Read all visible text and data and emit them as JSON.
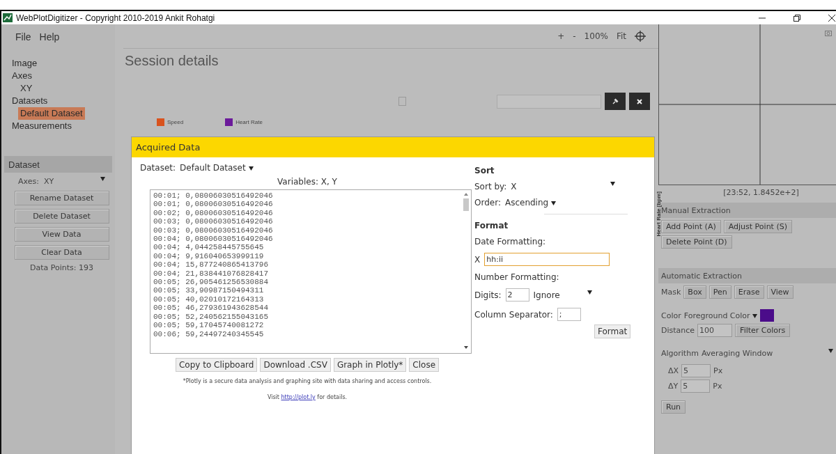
{
  "window": {
    "title": "WebPlotDigitizer - Copyright 2010-2019 Ankit Rohatgi"
  },
  "menu": [
    "File",
    "Help"
  ],
  "sidebar": {
    "items": [
      {
        "label": "Image",
        "selected": false
      },
      {
        "label": "Axes",
        "selected": false,
        "children": [
          {
            "label": "XY",
            "selected": false
          }
        ]
      },
      {
        "label": "Datasets",
        "selected": false,
        "children": [
          {
            "label": "Default Dataset",
            "selected": true
          }
        ]
      },
      {
        "label": "Measurements",
        "selected": false
      }
    ],
    "dataset_panel": {
      "title": "Dataset",
      "axes_label": "Axes:",
      "axes_value": "XY",
      "buttons": [
        "Rename Dataset",
        "Delete Dataset",
        "View Data",
        "Clear Data"
      ],
      "points": "Data Points: 193"
    }
  },
  "toolbar": {
    "zoom_in": "+",
    "zoom_out": "-",
    "zoom": "100%",
    "fit": "Fit"
  },
  "background_page": {
    "title": "Session details",
    "checkbox": {
      "checked": false
    },
    "legend": [
      {
        "label": "Speed",
        "color": "#d9531e"
      },
      {
        "label": "Heart Rate",
        "color": "#6b1a9a"
      }
    ],
    "axis_label": "Heart Rate [bpm]"
  },
  "dialog": {
    "title": "Acquired Data",
    "dataset_label": "Dataset:",
    "dataset_value": "Default Dataset",
    "variables": "Variables: X, Y",
    "rows": [
      "00:01; 0,08006030516492046",
      "00:01; 0,08006030516492046",
      "00:02; 0,08006030516492046",
      "00:03; 0,08006030516492046",
      "00:03; 0,08006030516492046",
      "00:04; 0,08006030516492046",
      "00:04; 4,044258445755645",
      "00:04; 9,916040653999119",
      "00:04; 15,877240865413796",
      "00:04; 21,838441076828417",
      "00:05; 26,905461256530884",
      "00:05; 33,90987150494311",
      "00:05; 40,02010172164313",
      "00:05; 46,279361943628544",
      "00:05; 52,240562155043165",
      "00:05; 59,17045740081272",
      "00:06; 59,24497240345545"
    ],
    "sort": {
      "heading": "Sort",
      "sort_by_label": "Sort by:",
      "sort_by": "X",
      "order_label": "Order:",
      "order": "Ascending"
    },
    "format": {
      "heading": "Format",
      "date_label": "Date Formatting:",
      "date_axis": "X",
      "date_value": "hh:ii",
      "number_label": "Number Formatting:",
      "digits_label": "Digits:",
      "digits": "2",
      "digits_mode": "Ignore",
      "separator_label": "Column Separator:",
      "separator": ";",
      "button": "Format"
    },
    "buttons": [
      "Copy to Clipboard",
      "Download .CSV",
      "Graph in Plotly*",
      "Close"
    ],
    "note": "*Plotly is a secure data analysis and graphing site with data sharing and access controls.",
    "visit": {
      "before": "Visit",
      "link": "http://plot.ly",
      "after": "for details."
    }
  },
  "right_panel": {
    "cursor": "[23:52, 1.8452e+2]",
    "manual": {
      "title": "Manual Extraction",
      "buttons": [
        "Add Point (A)",
        "Adjust Point (S)",
        "Delete Point (D)"
      ]
    },
    "automatic": {
      "title": "Automatic Extraction",
      "mask_label": "Mask",
      "mask_buttons": [
        "Box",
        "Pen",
        "Erase",
        "View"
      ],
      "color_label": "Color",
      "color_value": "Foreground Color",
      "distance_label": "Distance",
      "distance": "100",
      "filter_button": "Filter Colors",
      "algorithm_label": "Algorithm",
      "algorithm": "Averaging Window",
      "params": [
        {
          "label": "ΔX",
          "value": "5",
          "unit": "Px"
        },
        {
          "label": "ΔY",
          "value": "5",
          "unit": "Px"
        }
      ],
      "run": "Run"
    }
  }
}
